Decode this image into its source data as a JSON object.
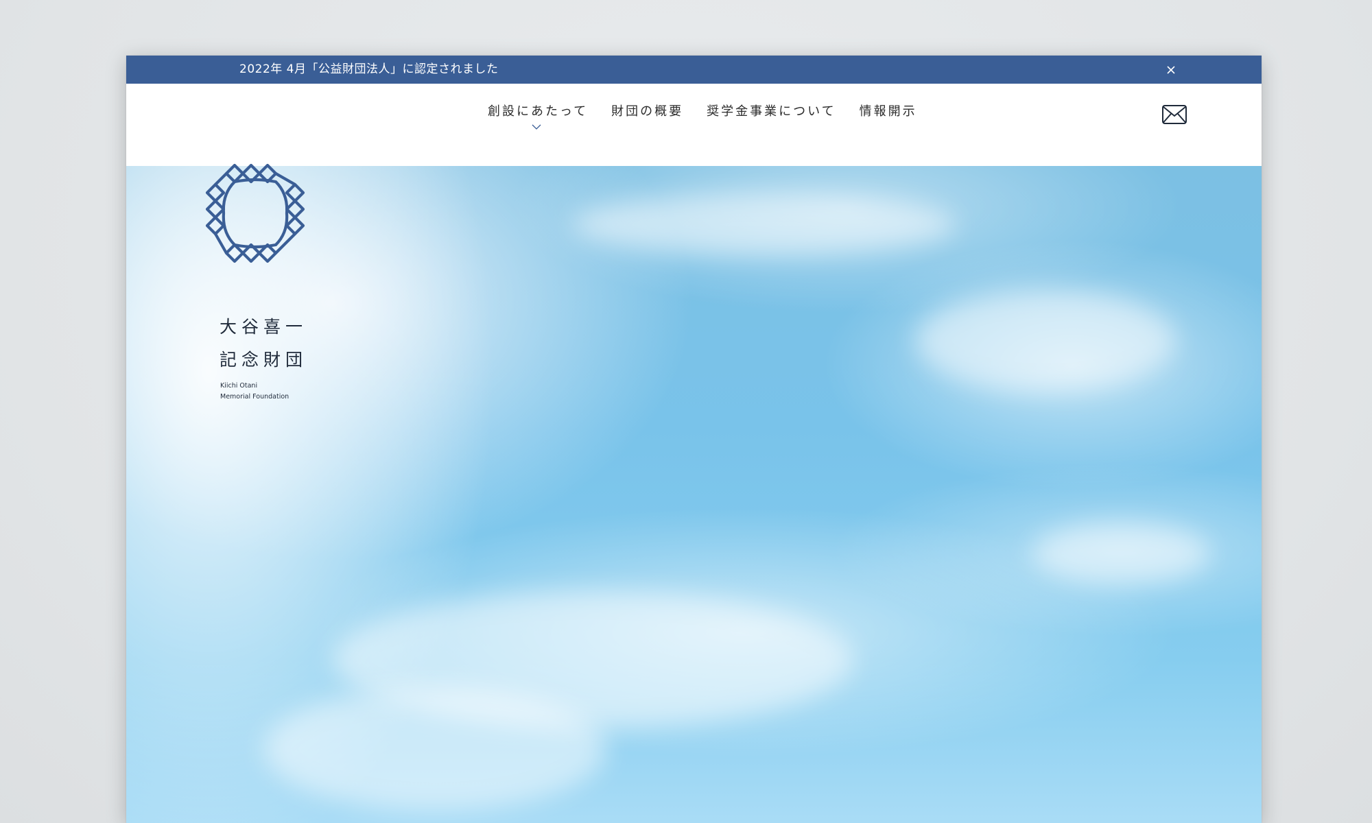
{
  "notice": {
    "text": "2022年 4月「公益財団法人」に認定されました",
    "close_icon": "close-icon"
  },
  "nav": {
    "items": [
      {
        "label": "創設にあたって",
        "has_dropdown": true
      },
      {
        "label": "財団の概要"
      },
      {
        "label": "奨学金事業について"
      },
      {
        "label": "情報開示"
      }
    ],
    "mail_icon": "mail-icon"
  },
  "logo": {
    "jp_line1": "大谷喜一",
    "jp_line2": "記念財団",
    "en_line1": "Kiichi Otani",
    "en_line2": "Memorial Foundation",
    "mark_icon": "knot-logo-icon"
  },
  "colors": {
    "brand_blue": "#3a5e96",
    "sky_blue": "#7cc0e3"
  }
}
